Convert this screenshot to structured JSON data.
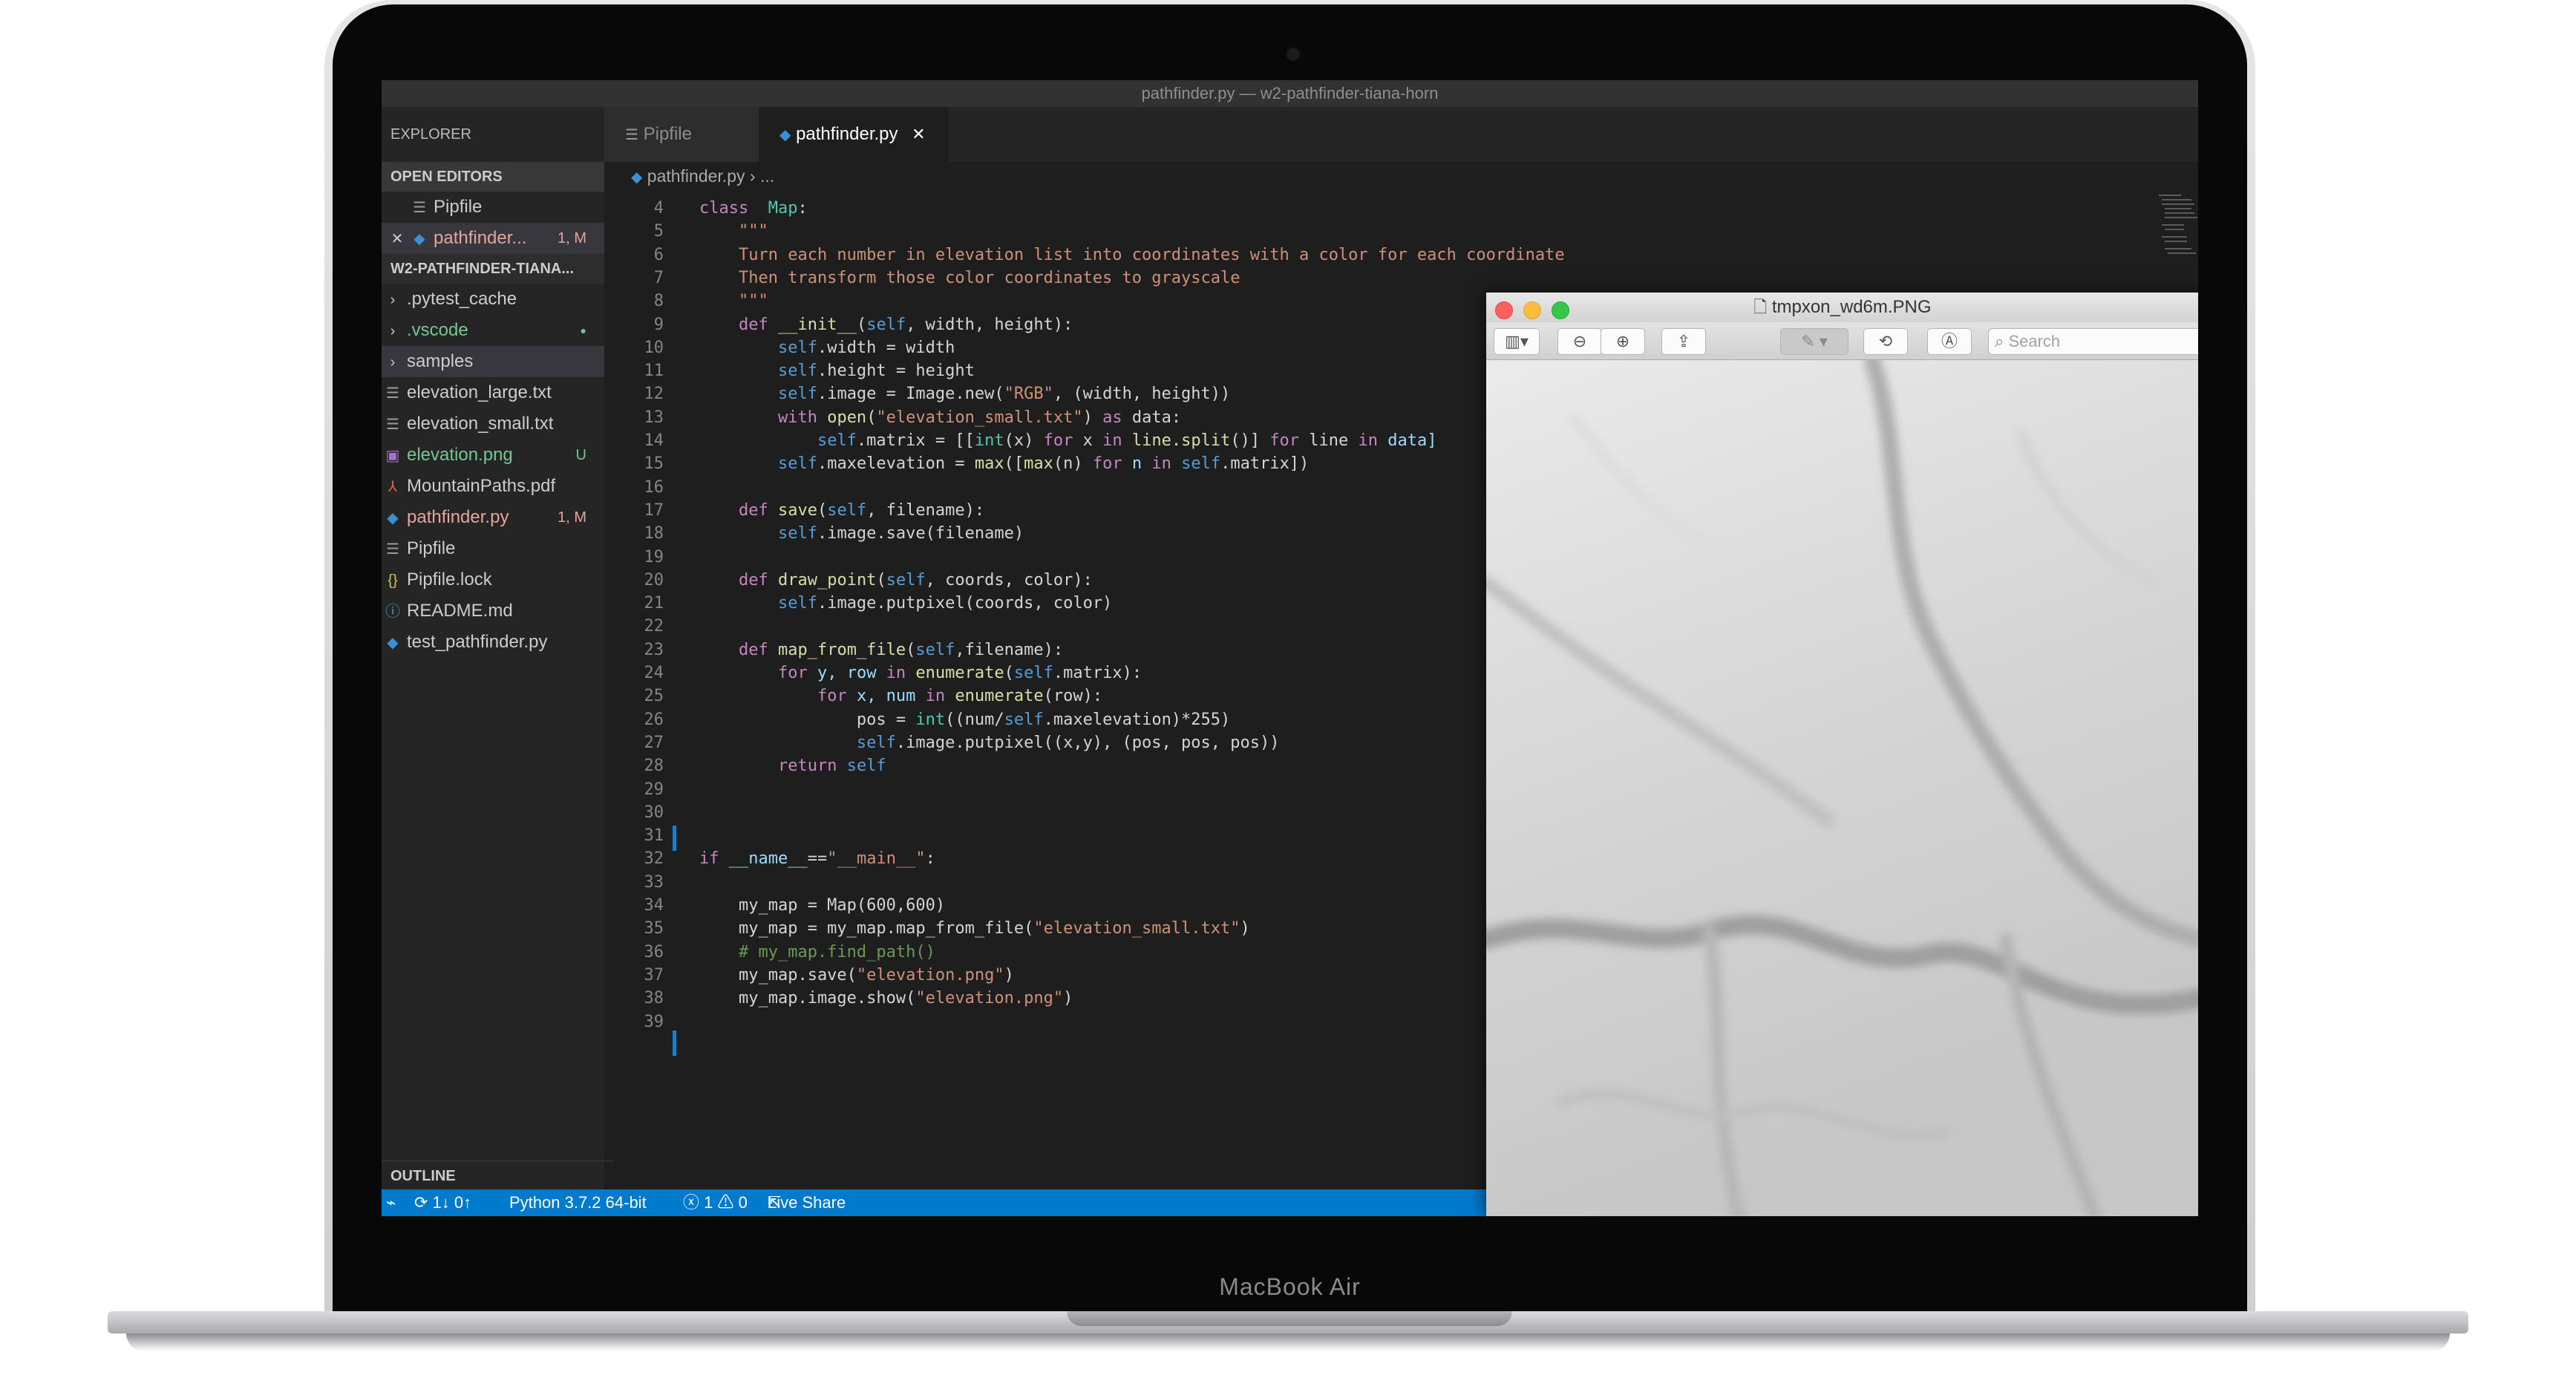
{
  "device": {
    "brand": "MacBook Air"
  },
  "window": {
    "title": "pathfinder.py — w2-pathfinder-tiana-horn"
  },
  "sidebar": {
    "header": "EXPLORER",
    "open_editors_label": "OPEN EDITORS",
    "open_editors": [
      {
        "name": "Pipfile",
        "icon": "lines-file-icon",
        "badge": ""
      },
      {
        "name": "pathfinder...",
        "icon": "python-icon",
        "badge": "1, M",
        "close": "✕"
      }
    ],
    "project_label": "W2-PATHFINDER-TIANA...",
    "files": [
      {
        "name": ".pytest_cache",
        "kind": "folder",
        "badge": ""
      },
      {
        "name": ".vscode",
        "kind": "folder",
        "badge": "●"
      },
      {
        "name": "samples",
        "kind": "folder",
        "badge": ""
      },
      {
        "name": "elevation_large.txt",
        "kind": "text",
        "badge": ""
      },
      {
        "name": "elevation_small.txt",
        "kind": "text",
        "badge": ""
      },
      {
        "name": "elevation.png",
        "kind": "image",
        "badge": "U"
      },
      {
        "name": "MountainPaths.pdf",
        "kind": "pdf",
        "badge": ""
      },
      {
        "name": "pathfinder.py",
        "kind": "python",
        "badge": "1, M"
      },
      {
        "name": "Pipfile",
        "kind": "text",
        "badge": ""
      },
      {
        "name": "Pipfile.lock",
        "kind": "json",
        "badge": ""
      },
      {
        "name": "README.md",
        "kind": "info",
        "badge": ""
      },
      {
        "name": "test_pathfinder.py",
        "kind": "python",
        "badge": ""
      }
    ],
    "outline_label": "OUTLINE"
  },
  "tabs": [
    {
      "label": "Pipfile",
      "icon": "lines-file-icon",
      "active": false
    },
    {
      "label": "pathfinder.py",
      "icon": "python-icon",
      "active": true,
      "close": "✕"
    }
  ],
  "breadcrumb": {
    "file": "pathfinder.py",
    "sep": "›",
    "rest": "..."
  },
  "editor": {
    "lines": [
      {
        "n": "4",
        "t": [
          [
            "kw",
            "class"
          ],
          [
            "",
            "  "
          ],
          [
            "cls",
            "Map"
          ],
          [
            "",
            ":"
          ]
        ]
      },
      {
        "n": "5",
        "t": [
          [
            "str",
            "    \"\"\""
          ]
        ]
      },
      {
        "n": "6",
        "t": [
          [
            "str",
            "    Turn each number in elevation list into coordinates with a color for each coordinate"
          ]
        ]
      },
      {
        "n": "7",
        "t": [
          [
            "str",
            "    Then transform those color coordinates to grayscale"
          ]
        ]
      },
      {
        "n": "8",
        "t": [
          [
            "str",
            "    \"\"\""
          ]
        ]
      },
      {
        "n": "9",
        "t": [
          [
            "",
            "    "
          ],
          [
            "kw",
            "def"
          ],
          [
            "",
            ""
          ],
          [
            "fn",
            " __init__"
          ],
          [
            "",
            "("
          ],
          [
            "self",
            "self"
          ],
          [
            "",
            ", width, height):"
          ]
        ]
      },
      {
        "n": "10",
        "t": [
          [
            "",
            "        "
          ],
          [
            "self",
            "self"
          ],
          [
            "",
            ".width = width"
          ]
        ]
      },
      {
        "n": "11",
        "t": [
          [
            "",
            "        "
          ],
          [
            "self",
            "self"
          ],
          [
            "",
            ".height = height"
          ]
        ]
      },
      {
        "n": "12",
        "t": [
          [
            "",
            "        "
          ],
          [
            "self",
            "self"
          ],
          [
            "",
            ".image = Image.new("
          ],
          [
            "str",
            "\"RGB\""
          ],
          [
            "",
            ", (width, height))"
          ]
        ]
      },
      {
        "n": "13",
        "t": [
          [
            "",
            "        "
          ],
          [
            "kw",
            "with"
          ],
          [
            "",
            ""
          ],
          [
            "fn",
            " open"
          ],
          [
            "",
            "("
          ],
          [
            "str",
            "\"elevation_small.txt\""
          ],
          [
            "",
            ") "
          ],
          [
            "kw",
            "as"
          ],
          [
            "",
            " data:"
          ]
        ]
      },
      {
        "n": "14",
        "t": [
          [
            "",
            "            "
          ],
          [
            "self",
            "self"
          ],
          [
            "",
            ".matrix = [["
          ],
          [
            "cls",
            "int"
          ],
          [
            "",
            "(x) "
          ],
          [
            "kw",
            "for"
          ],
          [
            "",
            " x "
          ],
          [
            "kw",
            "in"
          ],
          [
            "",
            ""
          ],
          [
            "fn",
            " line.split"
          ],
          [
            "",
            "()] "
          ],
          [
            "kw",
            "for"
          ],
          [
            "",
            " line "
          ],
          [
            "kw",
            "in"
          ],
          [
            "",
            ""
          ],
          [
            "ln",
            " data]"
          ]
        ]
      },
      {
        "n": "15",
        "t": [
          [
            "",
            "        "
          ],
          [
            "self",
            "self"
          ],
          [
            "",
            ".maxelevation = "
          ],
          [
            "fn",
            "max"
          ],
          [
            "",
            "(["
          ],
          [
            "fn",
            "max"
          ],
          [
            "",
            "(n) "
          ],
          [
            "kw",
            "for"
          ],
          [
            "",
            ""
          ],
          [
            "ln",
            " n "
          ],
          [
            "kw",
            "in"
          ],
          [
            "",
            ""
          ],
          [
            "self",
            " self"
          ],
          [
            "",
            ".matrix])"
          ]
        ]
      },
      {
        "n": "16",
        "t": []
      },
      {
        "n": "17",
        "t": [
          [
            "",
            "    "
          ],
          [
            "kw",
            "def"
          ],
          [
            "",
            ""
          ],
          [
            "fn",
            " save"
          ],
          [
            "",
            "("
          ],
          [
            "self",
            "self"
          ],
          [
            "",
            ", filename):"
          ]
        ]
      },
      {
        "n": "18",
        "t": [
          [
            "",
            "        "
          ],
          [
            "self",
            "self"
          ],
          [
            "",
            ".image.save(filename)"
          ]
        ]
      },
      {
        "n": "19",
        "t": []
      },
      {
        "n": "20",
        "t": [
          [
            "",
            "    "
          ],
          [
            "kw",
            "def"
          ],
          [
            "",
            ""
          ],
          [
            "fn",
            " draw_point"
          ],
          [
            "",
            "("
          ],
          [
            "self",
            "self"
          ],
          [
            "",
            ", coords, color):"
          ]
        ]
      },
      {
        "n": "21",
        "t": [
          [
            "",
            "        "
          ],
          [
            "self",
            "self"
          ],
          [
            "",
            ".image.putpixel(coords, color)"
          ]
        ]
      },
      {
        "n": "22",
        "t": []
      },
      {
        "n": "23",
        "t": [
          [
            "",
            "    "
          ],
          [
            "kw",
            "def"
          ],
          [
            "",
            ""
          ],
          [
            "fn",
            " map_from_file"
          ],
          [
            "",
            "("
          ],
          [
            "self",
            "self"
          ],
          [
            "",
            ",filename):"
          ]
        ]
      },
      {
        "n": "24",
        "t": [
          [
            "",
            "        "
          ],
          [
            "kw",
            "for"
          ],
          [
            "",
            ""
          ],
          [
            "ln",
            " y, row "
          ],
          [
            "kw",
            "in"
          ],
          [
            "",
            ""
          ],
          [
            "fn",
            " enumerate"
          ],
          [
            "",
            "("
          ],
          [
            "self",
            "self"
          ],
          [
            "",
            ".matrix):"
          ]
        ]
      },
      {
        "n": "25",
        "t": [
          [
            "",
            "            "
          ],
          [
            "kw",
            "for"
          ],
          [
            "",
            ""
          ],
          [
            "ln",
            " x, num "
          ],
          [
            "kw",
            "in"
          ],
          [
            "",
            ""
          ],
          [
            "fn",
            " enumerate"
          ],
          [
            "",
            "(row):"
          ]
        ]
      },
      {
        "n": "26",
        "t": [
          [
            "",
            "                pos = "
          ],
          [
            "cls",
            "int"
          ],
          [
            "",
            "((num/"
          ],
          [
            "self",
            "self"
          ],
          [
            "",
            ".maxelevation)*255)"
          ]
        ]
      },
      {
        "n": "27",
        "t": [
          [
            "",
            "                "
          ],
          [
            "self",
            "self"
          ],
          [
            "",
            ".image.putpixel((x,y), (pos, pos, pos))"
          ]
        ]
      },
      {
        "n": "28",
        "t": [
          [
            "",
            "        "
          ],
          [
            "kw",
            "return"
          ],
          [
            "",
            ""
          ],
          [
            "self",
            " self"
          ]
        ]
      },
      {
        "n": "29",
        "t": []
      },
      {
        "n": "30",
        "t": []
      },
      {
        "n": "31",
        "t": []
      },
      {
        "n": "32",
        "t": [
          [
            "kw",
            "if"
          ],
          [
            "",
            ""
          ],
          [
            "ln",
            " __name__"
          ],
          [
            "",
            "=="
          ],
          [
            "str",
            "\"__main__\""
          ],
          [
            "",
            ":"
          ]
        ]
      },
      {
        "n": "33",
        "t": []
      },
      {
        "n": "34",
        "t": [
          [
            "",
            "    my_map = Map(600,600)"
          ]
        ]
      },
      {
        "n": "35",
        "t": [
          [
            "",
            "    my_map = my_map.map_from_file("
          ],
          [
            "str",
            "\"elevation_small.txt\""
          ],
          [
            "",
            ")"
          ]
        ]
      },
      {
        "n": "36",
        "t": [
          [
            "cmt",
            "    # my_map.find_path()"
          ]
        ]
      },
      {
        "n": "37",
        "t": [
          [
            "",
            "    my_map.save("
          ],
          [
            "str",
            "\"elevation.png\""
          ],
          [
            "",
            ")"
          ]
        ]
      },
      {
        "n": "38",
        "t": [
          [
            "",
            "    my_map.image.show("
          ],
          [
            "str",
            "\"elevation.png\""
          ],
          [
            "",
            ")"
          ]
        ]
      },
      {
        "n": "39",
        "t": []
      }
    ]
  },
  "statusbar": {
    "remote": "⌁",
    "sync": "⟳ 1↓ 0↑",
    "interpreter": "Python 3.7.2 64-bit",
    "problems": "ⓧ 1 ⚠ 0",
    "live_share": "Live Share"
  },
  "preview": {
    "title": "tmpxon_wd6m.PNG",
    "search_placeholder": "Search",
    "toolbar_icons": [
      "sidebar-toggle-icon",
      "zoom-out-icon",
      "zoom-in-icon",
      "share-icon",
      "markup-pen-icon",
      "rotate-icon",
      "annotate-icon"
    ]
  },
  "colors": {
    "keyword": "#c586c0",
    "function": "#dcdcaa",
    "string": "#ce9178",
    "self": "#569cd6",
    "class": "#4ec9b0",
    "comment": "#6a9955",
    "variable": "#9cdcfe",
    "statusbar": "#007acc",
    "modified_file": "#e2a69d",
    "untracked_file": "#73c991"
  }
}
